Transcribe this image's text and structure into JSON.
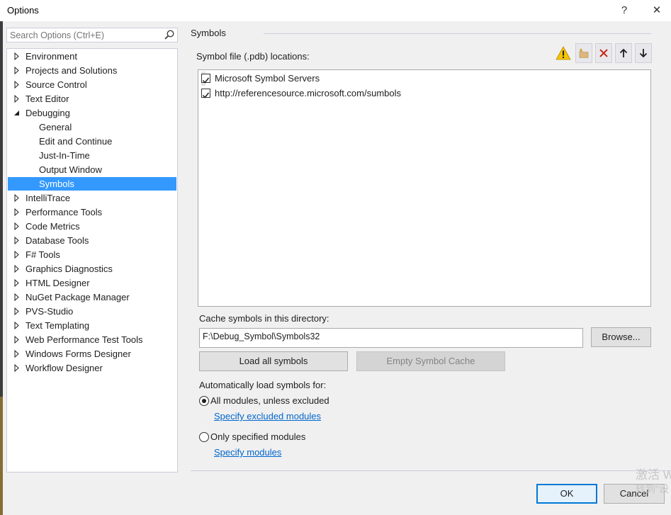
{
  "window": {
    "title": "Options",
    "help_label": "?",
    "close_label": "✕"
  },
  "search": {
    "placeholder": "Search Options (Ctrl+E)"
  },
  "tree": {
    "items": [
      {
        "label": "Environment",
        "expanded": false
      },
      {
        "label": "Projects and Solutions",
        "expanded": false
      },
      {
        "label": "Source Control",
        "expanded": false
      },
      {
        "label": "Text Editor",
        "expanded": false
      },
      {
        "label": "Debugging",
        "expanded": true
      },
      {
        "label": "General",
        "child": true
      },
      {
        "label": "Edit and Continue",
        "child": true
      },
      {
        "label": "Just-In-Time",
        "child": true
      },
      {
        "label": "Output Window",
        "child": true
      },
      {
        "label": "Symbols",
        "child": true,
        "selected": true
      },
      {
        "label": "IntelliTrace",
        "expanded": false
      },
      {
        "label": "Performance Tools",
        "expanded": false
      },
      {
        "label": "Code Metrics",
        "expanded": false
      },
      {
        "label": "Database Tools",
        "expanded": false
      },
      {
        "label": "F# Tools",
        "expanded": false
      },
      {
        "label": "Graphics Diagnostics",
        "expanded": false
      },
      {
        "label": "HTML Designer",
        "expanded": false
      },
      {
        "label": "NuGet Package Manager",
        "expanded": false
      },
      {
        "label": "PVS-Studio",
        "expanded": false
      },
      {
        "label": "Text Templating",
        "expanded": false
      },
      {
        "label": "Web Performance Test Tools",
        "expanded": false
      },
      {
        "label": "Windows Forms Designer",
        "expanded": false
      },
      {
        "label": "Workflow Designer",
        "expanded": false
      }
    ]
  },
  "page": {
    "section_title": "Symbols",
    "locations_label": "Symbol file (.pdb) locations:",
    "locations": [
      {
        "label": "Microsoft Symbol Servers",
        "checked": true
      },
      {
        "label": "http://referencesource.microsoft.com/sumbols",
        "checked": true
      }
    ],
    "cache_label": "Cache symbols in this directory:",
    "cache_value": "F:\\Debug_Symbol\\Symbols32",
    "browse_label": "Browse...",
    "load_all_label": "Load all symbols",
    "empty_cache_label": "Empty Symbol Cache",
    "auto_load_label": "Automatically load symbols for:",
    "radio_all_label": "All modules, unless excluded",
    "specify_excluded_label": "Specify excluded modules",
    "radio_only_label": "Only specified modules",
    "specify_modules_label": "Specify modules",
    "selected_radio": "all"
  },
  "footer": {
    "ok_label": "OK",
    "cancel_label": "Cancel"
  },
  "watermark": {
    "line1": "激活 W",
    "line2": "转到\"设"
  },
  "colors": {
    "selection": "#3399ff",
    "link": "#0066cc",
    "warning": "#f5c400",
    "delete": "#c42b1c",
    "primary_border": "#0078d7"
  }
}
